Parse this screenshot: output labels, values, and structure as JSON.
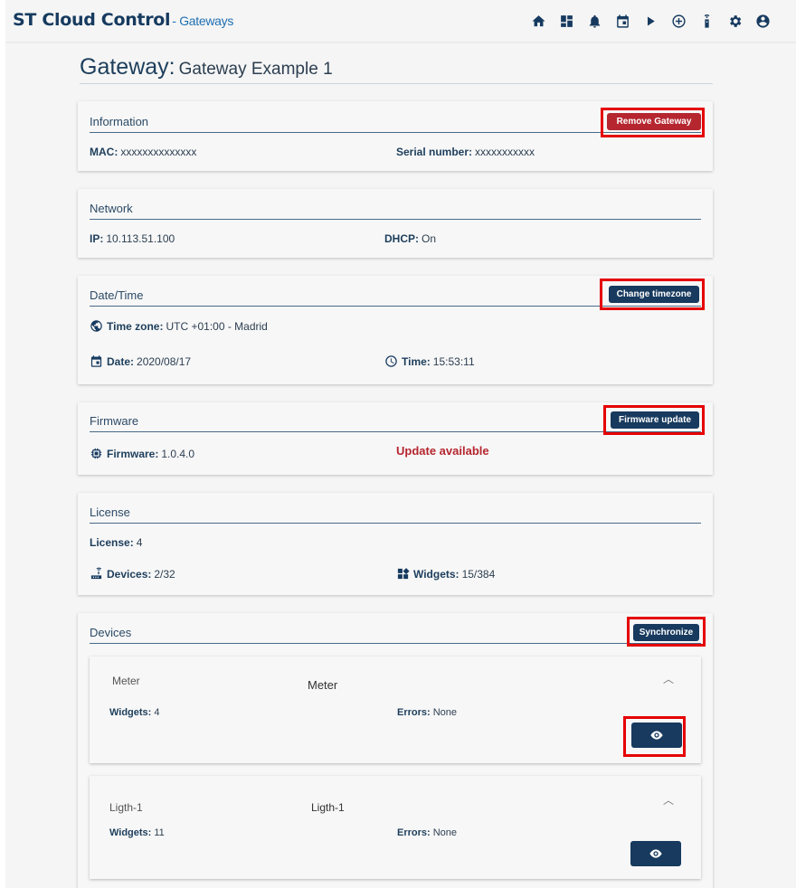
{
  "app": {
    "title": "ST Cloud Control",
    "section": "- Gateways"
  },
  "nav_icons": [
    "home-icon",
    "dashboard-icon",
    "bell-icon",
    "calendar-icon",
    "play-icon",
    "add-circle-icon",
    "remote-icon",
    "gear-icon",
    "account-icon"
  ],
  "page": {
    "title": "Gateway:",
    "name": "Gateway Example 1"
  },
  "information": {
    "heading": "Information",
    "remove_label": "Remove Gateway",
    "mac_label": "MAC:",
    "mac_value": "xxxxxxxxxxxxxx",
    "serial_label": "Serial number:",
    "serial_value": "xxxxxxxxxxx"
  },
  "network": {
    "heading": "Network",
    "ip_label": "IP:",
    "ip_value": "10.113.51.100",
    "dhcp_label": "DHCP:",
    "dhcp_value": "On"
  },
  "datetime": {
    "heading": "Date/Time",
    "change_label": "Change timezone",
    "tz_label": "Time zone:",
    "tz_value": "UTC +01:00 - Madrid",
    "date_label": "Date:",
    "date_value": "2020/08/17",
    "time_label": "Time:",
    "time_value": "15:53:11"
  },
  "firmware": {
    "heading": "Firmware",
    "update_label": "Firmware update",
    "fw_label": "Firmware:",
    "fw_value": "1.0.4.0",
    "status": "Update available"
  },
  "license": {
    "heading": "License",
    "license_label": "License:",
    "license_value": "4",
    "devices_label": "Devices:",
    "devices_value": "2/32",
    "widgets_label": "Widgets:",
    "widgets_value": "15/384"
  },
  "devices": {
    "heading": "Devices",
    "sync_label": "Synchronize",
    "items": [
      {
        "id": "Meter",
        "name": "Meter",
        "widgets_label": "Widgets:",
        "widgets": "4",
        "errors_label": "Errors:",
        "errors": "None"
      },
      {
        "id": "Ligth-1",
        "name": "Ligth-1",
        "widgets_label": "Widgets:",
        "widgets": "11",
        "errors_label": "Errors:",
        "errors": "None"
      }
    ]
  },
  "colors": {
    "primary": "#173a5e",
    "danger": "#b5262f",
    "highlight": "#e50000"
  }
}
